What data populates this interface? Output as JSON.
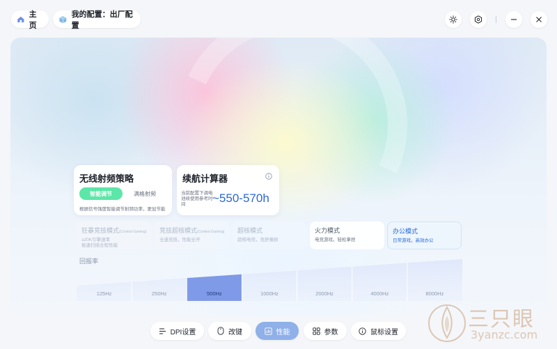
{
  "header": {
    "home_label": "主页",
    "config_label": "我的配置：出厂配置"
  },
  "cards": {
    "rf": {
      "title": "无线射频策略",
      "smart_label": "智能调节",
      "full_label": "满格射频",
      "description": "根据信号强度智能调节射频功率，更加节能"
    },
    "battery": {
      "title": "续航计算器",
      "description": "当前配置下调电池续使用参考时间",
      "value": "~550-570h"
    }
  },
  "modes": [
    {
      "title": "狂暴竞技模式",
      "subtitle": "(Contest Gaming)",
      "desc": "≥20K引擎速率\n极速扫描全程性能",
      "state": "faded"
    },
    {
      "title": "竞技超核模式",
      "subtitle": "(Contest Gaming)",
      "desc": "全速竞技，性能全开",
      "state": "faded"
    },
    {
      "title": "超核模式",
      "subtitle": "",
      "desc": "超核电竞，竞舒兼顾",
      "state": "faded"
    },
    {
      "title": "火力模式",
      "subtitle": "",
      "desc": "电竞游戏，轻松拿捏",
      "state": "normal"
    },
    {
      "title": "办公模式",
      "subtitle": "",
      "desc": "日常游戏，高效办公",
      "state": "active"
    }
  ],
  "polling": {
    "label": "回报率",
    "rates": [
      "125Hz",
      "250Hz",
      "500Hz",
      "1000Hz",
      "2000Hz",
      "4000Hz",
      "8000Hz"
    ],
    "selected": "500Hz"
  },
  "nav": {
    "dpi": "DPI设置",
    "keys": "改键",
    "performance": "性能",
    "params": "参数",
    "mouse": "鼠标设置"
  },
  "watermark": {
    "text": "三只眼",
    "url": "3yanzc.com"
  },
  "colors": {
    "accent": "#2a68d8",
    "toggle_active": "#5ce6a8",
    "nav_active": "#8fb0e8",
    "poll_selected": "#7f9ae6"
  }
}
